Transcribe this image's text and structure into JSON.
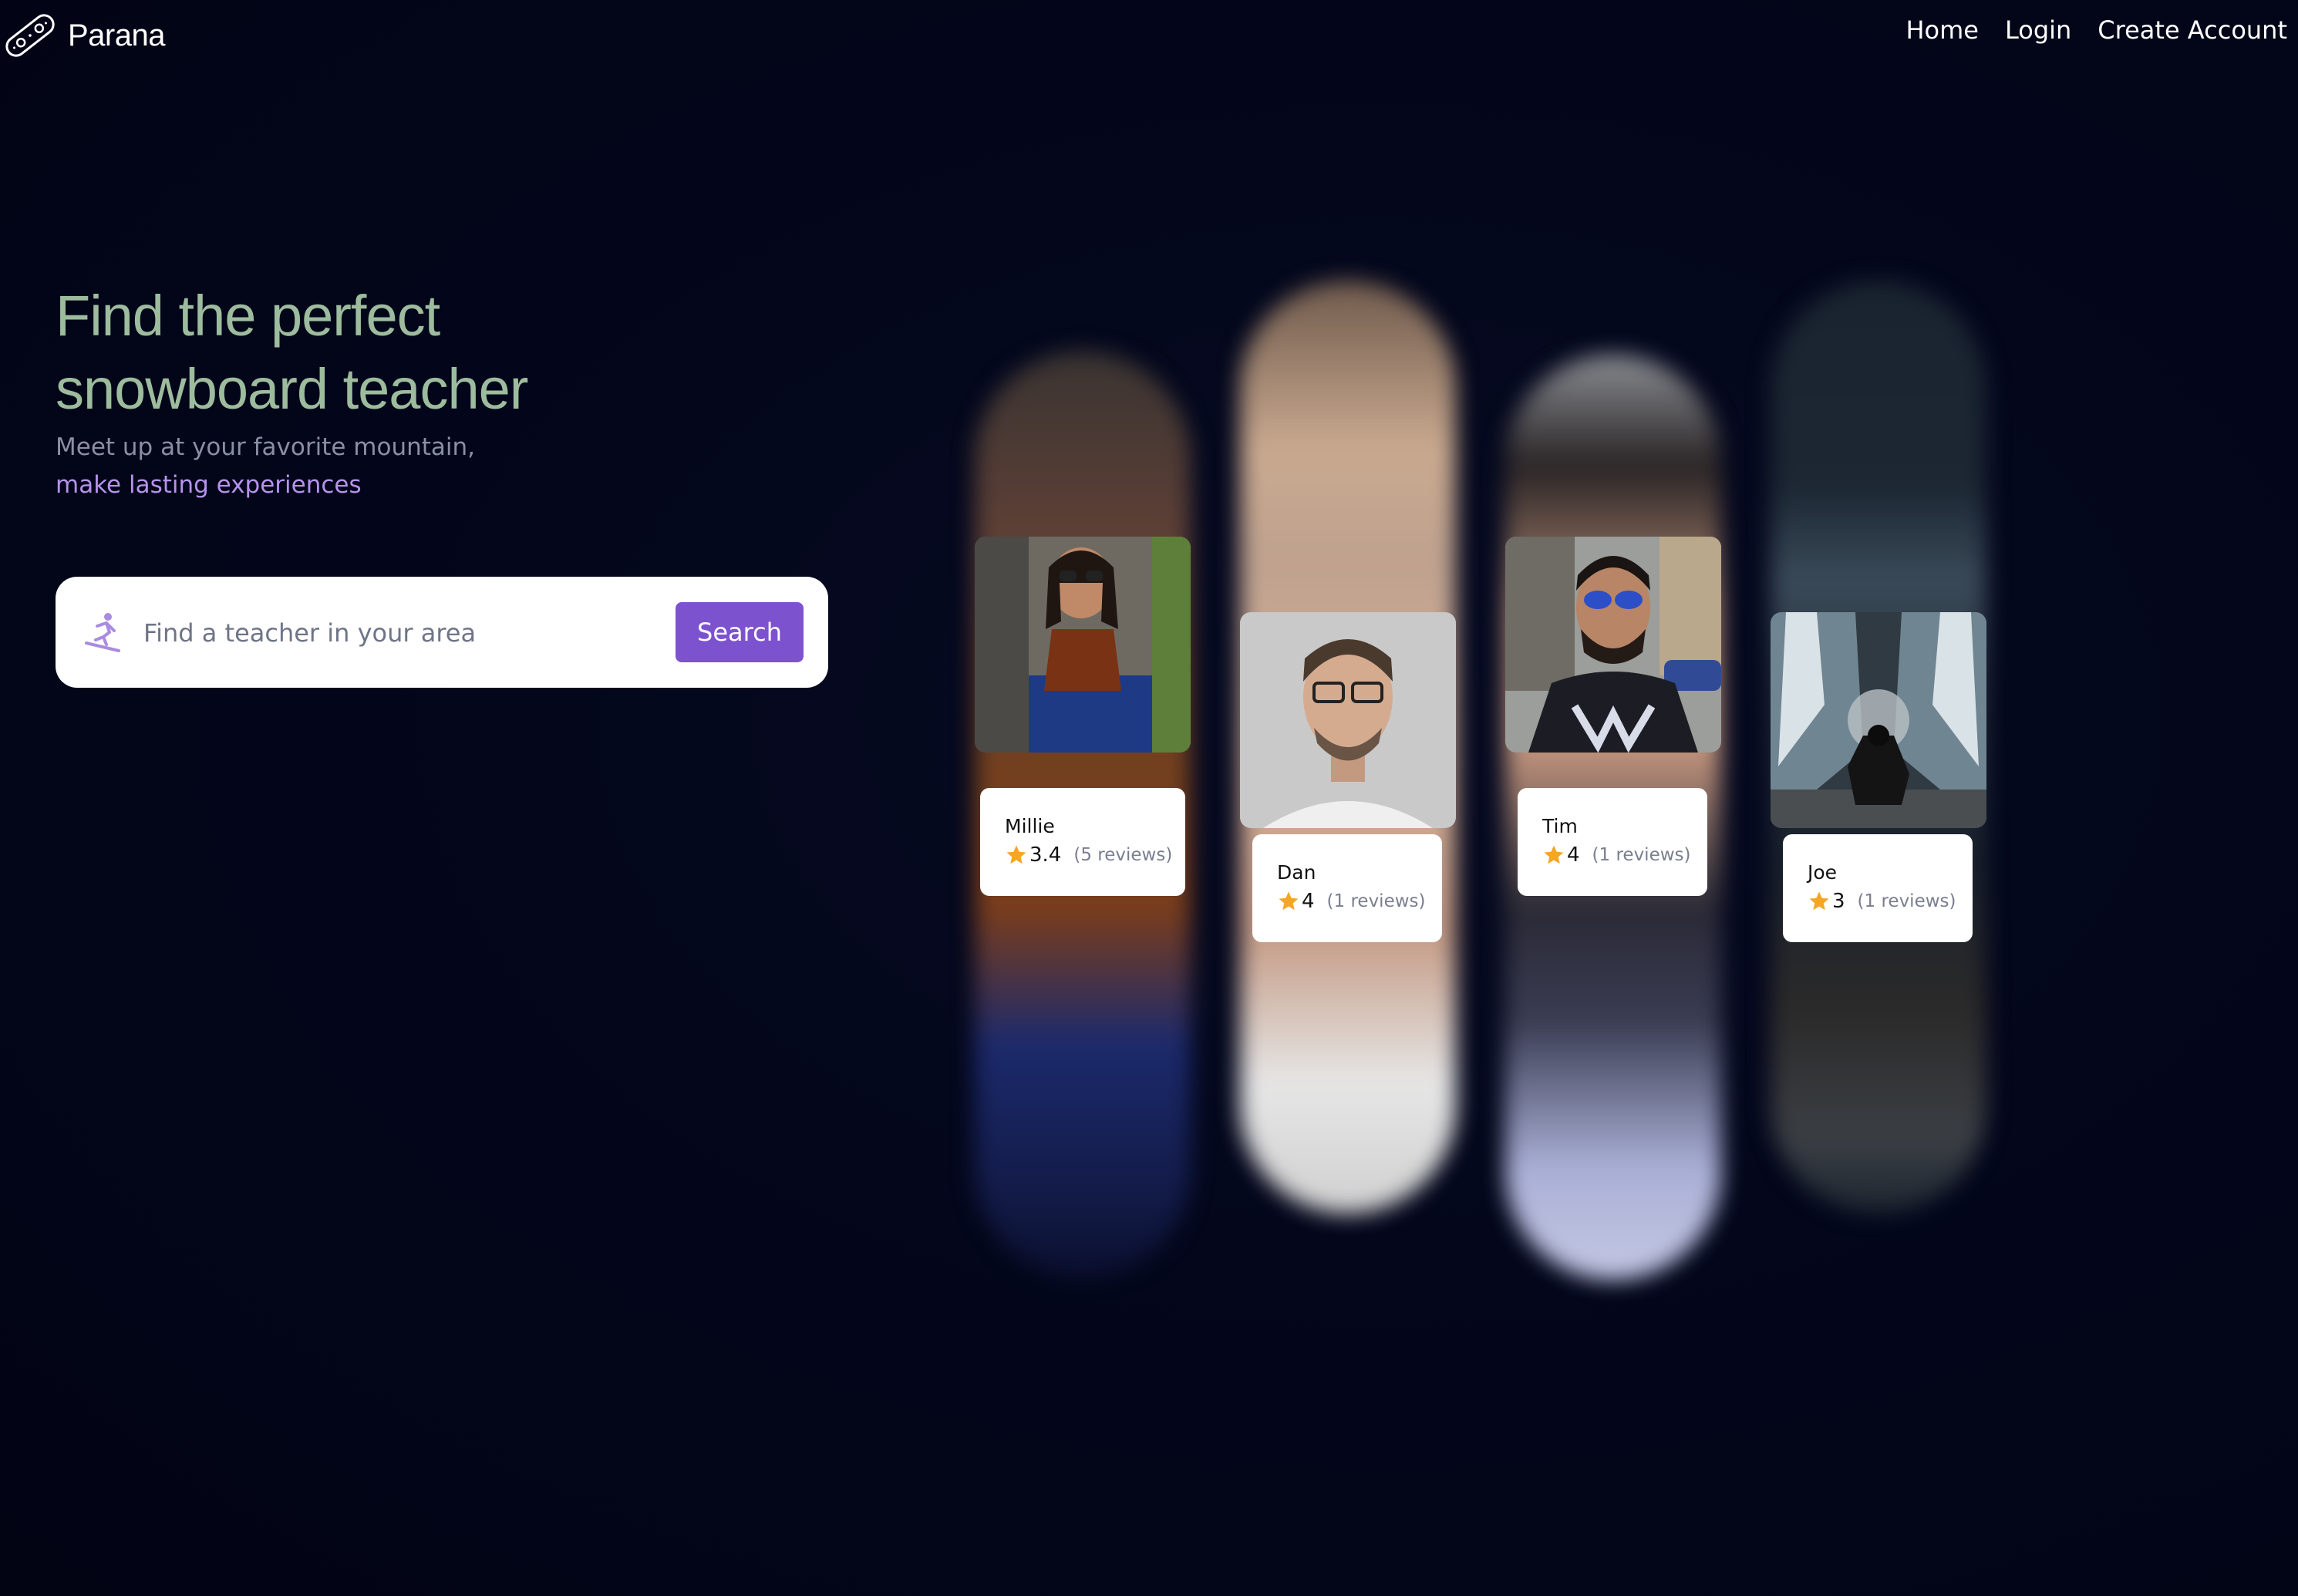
{
  "nav": {
    "brand": "Parana",
    "links": [
      "Home",
      "Login",
      "Create Account"
    ]
  },
  "hero": {
    "title_line1": "Find the perfect",
    "title_line2": "snowboard teacher",
    "subtitle_line1": "Meet up at your favorite mountain,",
    "subtitle_line2": "make lasting experiences"
  },
  "search": {
    "placeholder": "Find a teacher in your area",
    "value": "",
    "button_label": "Search",
    "icon": "snowboarder-icon"
  },
  "teachers": [
    {
      "name": "Millie",
      "rating": "3.4",
      "reviews": "(5 reviews)"
    },
    {
      "name": "Dan",
      "rating": "4",
      "reviews": "(1 reviews)"
    },
    {
      "name": "Tim",
      "rating": "4",
      "reviews": "(1 reviews)"
    },
    {
      "name": "Joe",
      "rating": "3",
      "reviews": "(1 reviews)"
    }
  ],
  "colors": {
    "background": "#03061a",
    "title_green": "#9dbc9e",
    "accent_purple": "#7d52cf",
    "highlight_purple": "#b592ec",
    "star": "#f5a623"
  }
}
